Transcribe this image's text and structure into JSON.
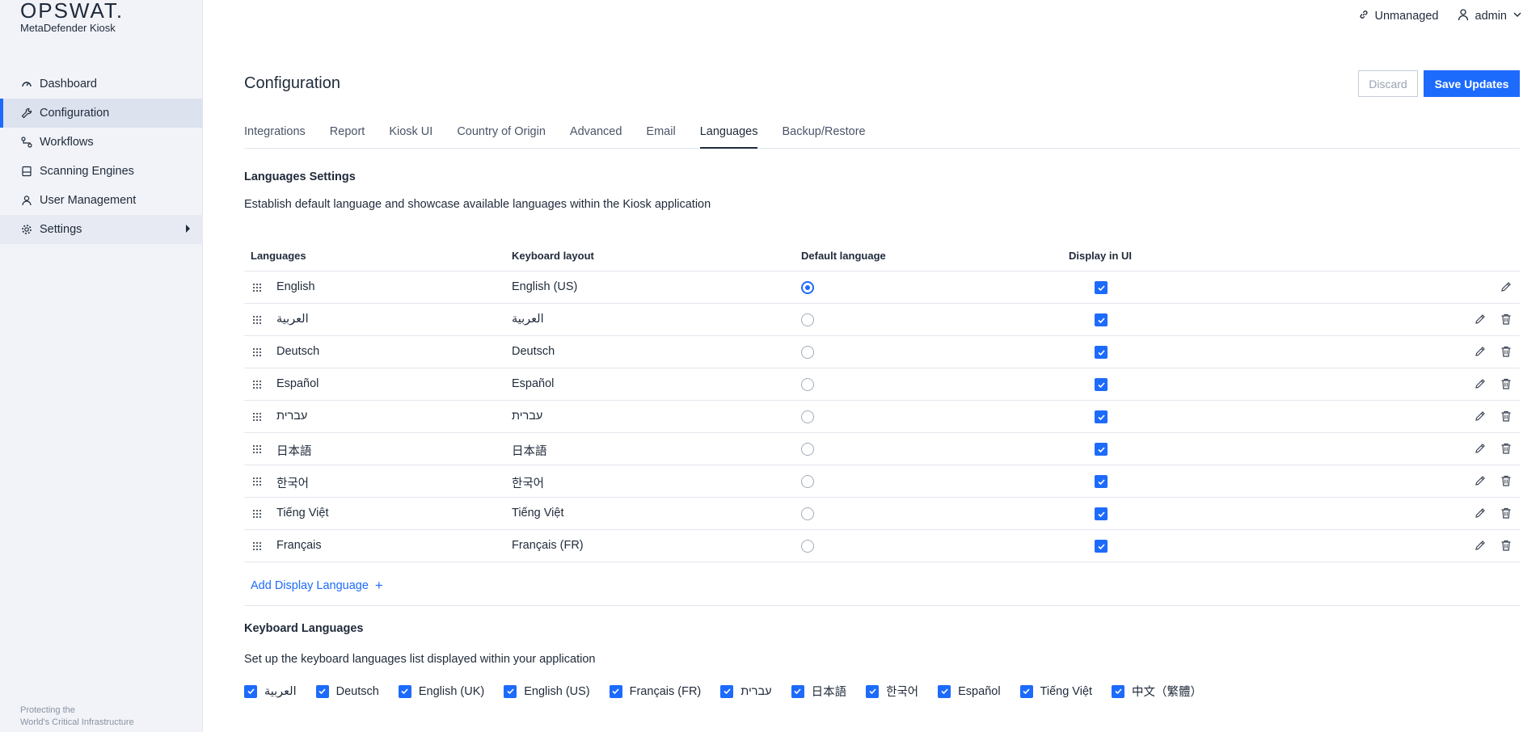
{
  "brand": {
    "logo": "OPSWAT.",
    "product": "MetaDefender Kiosk"
  },
  "sidebar": {
    "items": [
      {
        "label": "Dashboard",
        "icon": "dashboard-icon"
      },
      {
        "label": "Configuration",
        "icon": "wrench-icon"
      },
      {
        "label": "Workflows",
        "icon": "workflow-icon"
      },
      {
        "label": "Scanning Engines",
        "icon": "engine-icon"
      },
      {
        "label": "User Management",
        "icon": "users-icon"
      },
      {
        "label": "Settings",
        "icon": "gear-icon"
      }
    ],
    "footer_line1": "Protecting the",
    "footer_line2": "World's Critical Infrastructure"
  },
  "topbar": {
    "status": "Unmanaged",
    "user": "admin"
  },
  "page": {
    "title": "Configuration",
    "discard": "Discard",
    "save": "Save Updates",
    "tabs": [
      "Integrations",
      "Report",
      "Kiosk UI",
      "Country of Origin",
      "Advanced",
      "Email",
      "Languages",
      "Backup/Restore"
    ],
    "active_tab": "Languages"
  },
  "languages_settings": {
    "title": "Languages Settings",
    "description": "Establish default language and showcase available languages within the Kiosk application",
    "headers": {
      "languages": "Languages",
      "keyboard": "Keyboard layout",
      "default": "Default language",
      "display": "Display in UI"
    },
    "rows": [
      {
        "language": "English",
        "keyboard": "English (US)",
        "default": true,
        "display": true,
        "deletable": false
      },
      {
        "language": "العربية",
        "keyboard": "العربية",
        "default": false,
        "display": true,
        "deletable": true
      },
      {
        "language": "Deutsch",
        "keyboard": "Deutsch",
        "default": false,
        "display": true,
        "deletable": true
      },
      {
        "language": "Español",
        "keyboard": "Español",
        "default": false,
        "display": true,
        "deletable": true
      },
      {
        "language": "עברית",
        "keyboard": "עברית",
        "default": false,
        "display": true,
        "deletable": true
      },
      {
        "language": "日本語",
        "keyboard": "日本語",
        "default": false,
        "display": true,
        "deletable": true
      },
      {
        "language": "한국어",
        "keyboard": "한국어",
        "default": false,
        "display": true,
        "deletable": true
      },
      {
        "language": "Tiếng Việt",
        "keyboard": "Tiếng Việt",
        "default": false,
        "display": true,
        "deletable": true
      },
      {
        "language": "Français",
        "keyboard": "Français (FR)",
        "default": false,
        "display": true,
        "deletable": true
      }
    ],
    "add_label": "Add Display Language",
    "add_symbol": "+"
  },
  "keyboard_languages": {
    "title": "Keyboard Languages",
    "description": "Set up the keyboard languages list displayed within your application",
    "items": [
      "العربية",
      "Deutsch",
      "English (UK)",
      "English (US)",
      "Français (FR)",
      "עברית",
      "日本語",
      "한국어",
      "Español",
      "Tiếng Việt",
      "中文（繁體）"
    ]
  },
  "colors": {
    "accent": "#1d6bfc",
    "sidebar_bg": "#f1f3f8",
    "text": "#1f2a3a"
  }
}
